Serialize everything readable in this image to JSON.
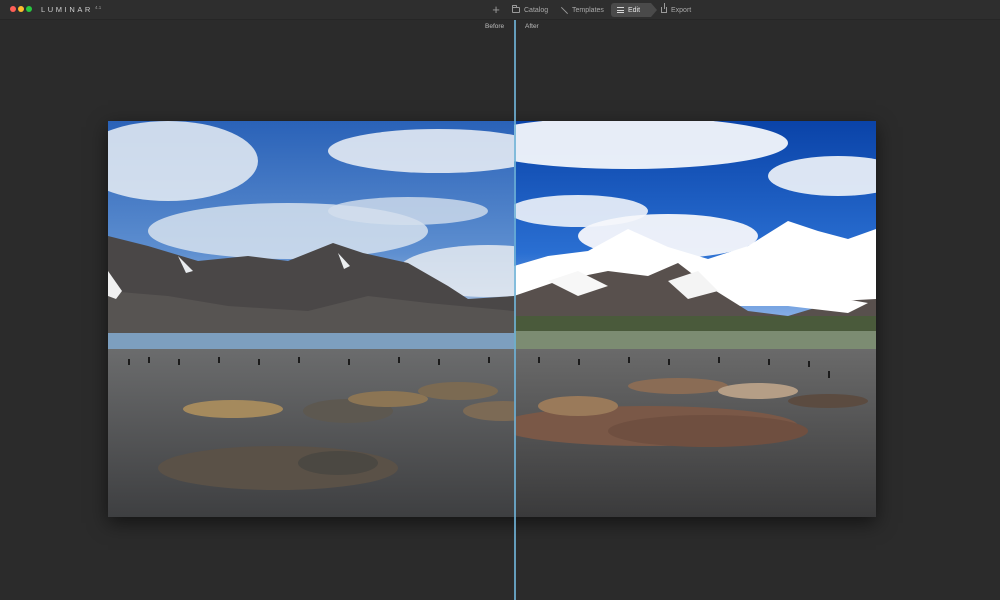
{
  "app": {
    "logo": "LUMINAR",
    "version": "4.1"
  },
  "titlebar": {
    "add_icon": "plus-icon",
    "nav": [
      {
        "label": "Catalog",
        "icon": "folder-icon",
        "active": false
      },
      {
        "label": "Templates",
        "icon": "magic-wand-icon",
        "active": false
      },
      {
        "label": "Edit",
        "icon": "sliders-icon",
        "active": true
      },
      {
        "label": "Export",
        "icon": "share-icon",
        "active": false
      }
    ]
  },
  "compare": {
    "before_label": "Before",
    "after_label": "After",
    "split_color": "#6fb2d6"
  },
  "colors": {
    "background": "#2b2b2b",
    "titlebar": "#2e2e2e",
    "active_tab": "#4a4a4a"
  }
}
